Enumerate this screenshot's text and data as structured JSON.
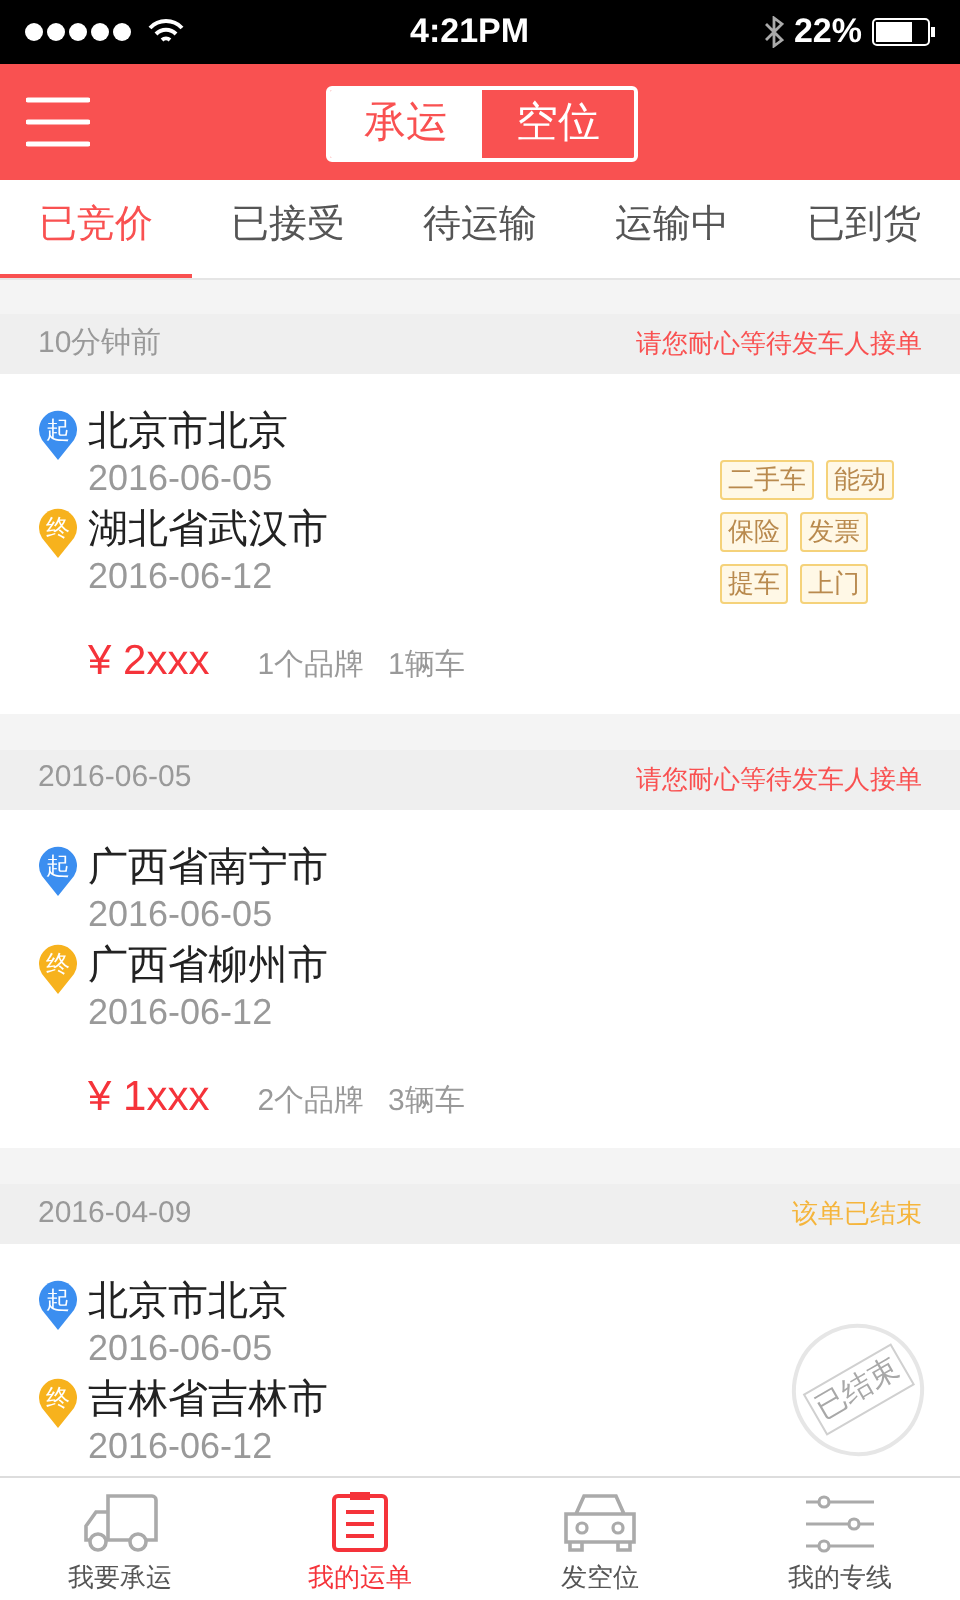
{
  "status_bar": {
    "time": "4:21PM",
    "battery": "22%"
  },
  "header": {
    "segments": [
      {
        "label": "承运",
        "selected": true
      },
      {
        "label": "空位",
        "selected": false
      }
    ]
  },
  "tabs": [
    {
      "label": "已竞价",
      "selected": true
    },
    {
      "label": "已接受",
      "selected": false
    },
    {
      "label": "待运输",
      "selected": false
    },
    {
      "label": "运输中",
      "selected": false
    },
    {
      "label": "已到货",
      "selected": false
    }
  ],
  "orders": [
    {
      "time": "10分钟前",
      "status": "请您耐心等待发车人接单",
      "kind": "waiting",
      "origin": {
        "pin": "起",
        "city": "北京市北京",
        "date": "2016-06-05"
      },
      "destination": {
        "pin": "终",
        "city": "湖北省武汉市",
        "date": "2016-06-12"
      },
      "tags": [
        "二手车",
        "能动",
        "保险",
        "发票",
        "提车",
        "上门"
      ],
      "price": "¥ 2xxx",
      "brands": "1个品牌",
      "vehicles": "1辆车"
    },
    {
      "time": "2016-06-05",
      "status": "请您耐心等待发车人接单",
      "kind": "waiting",
      "origin": {
        "pin": "起",
        "city": "广西省南宁市",
        "date": "2016-06-05"
      },
      "destination": {
        "pin": "终",
        "city": "广西省柳州市",
        "date": "2016-06-12"
      },
      "price": "¥ 1xxx",
      "brands": "2个品牌",
      "vehicles": "3辆车"
    },
    {
      "time": "2016-04-09",
      "status": "该单已结束",
      "kind": "ended",
      "origin": {
        "pin": "起",
        "city": "北京市北京",
        "date": "2016-06-05"
      },
      "destination": {
        "pin": "终",
        "city": "吉林省吉林市",
        "date": "2016-06-12"
      },
      "stamp": "已结束"
    }
  ],
  "bottom_nav": [
    {
      "label": "我要承运",
      "kind": "truck",
      "selected": false
    },
    {
      "label": "我的运单",
      "kind": "clipboard",
      "selected": true
    },
    {
      "label": "发空位",
      "kind": "car",
      "selected": false
    },
    {
      "label": "我的专线",
      "kind": "sliders",
      "selected": false
    }
  ]
}
